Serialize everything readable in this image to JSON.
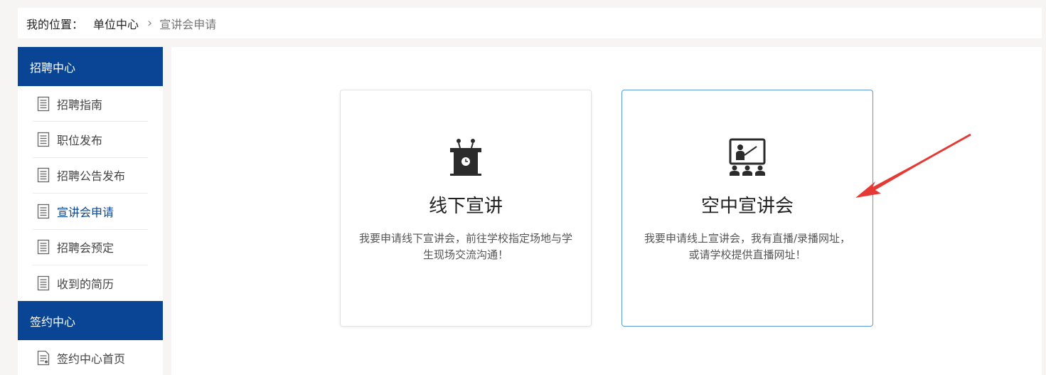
{
  "breadcrumb": {
    "prefix": "我的位置：",
    "parent": "单位中心",
    "current": "宣讲会申请"
  },
  "sidebar": {
    "recruit_header": "招聘中心",
    "recruit_items": [
      {
        "label": "招聘指南",
        "active": false
      },
      {
        "label": "职位发布",
        "active": false
      },
      {
        "label": "招聘公告发布",
        "active": false
      },
      {
        "label": "宣讲会申请",
        "active": true
      },
      {
        "label": "招聘会预定",
        "active": false
      },
      {
        "label": "收到的简历",
        "active": false
      }
    ],
    "sign_header": "签约中心",
    "sign_items": [
      {
        "label": "签约中心首页",
        "active": false
      }
    ]
  },
  "cards": {
    "offline": {
      "icon": "podium-icon",
      "title": "线下宣讲",
      "desc": "我要申请线下宣讲会，前往学校指定场地与学生现场交流沟通！"
    },
    "online": {
      "icon": "presentation-screen-icon",
      "title": "空中宣讲会",
      "desc": "我要申请线上宣讲会，我有直播/录播网址，或请学校提供直播网址！"
    }
  },
  "colors": {
    "brand": "#0a4595",
    "selected_border": "#5a9ad6",
    "annotation_arrow": "#e53935"
  }
}
